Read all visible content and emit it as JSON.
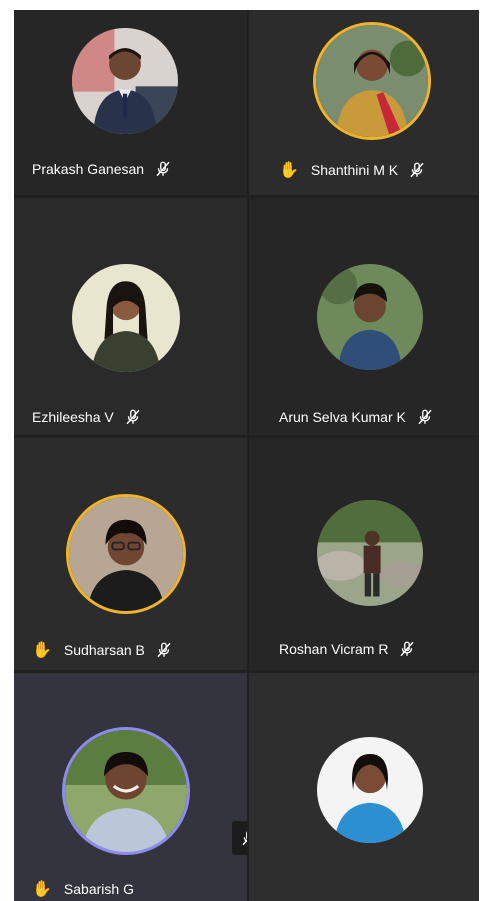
{
  "participants": [
    {
      "name": "Prakash Ganesan",
      "hand_raised": false,
      "muted": true
    },
    {
      "name": "Shanthini M K",
      "hand_raised": true,
      "muted": true
    },
    {
      "name": "Ezhileesha V",
      "hand_raised": false,
      "muted": true
    },
    {
      "name": "Arun Selva Kumar K",
      "hand_raised": false,
      "muted": true
    },
    {
      "name": "Sudharsan B",
      "hand_raised": true,
      "muted": true
    },
    {
      "name": "Roshan Vicram R",
      "hand_raised": false,
      "muted": true
    },
    {
      "name": "Sabarish G",
      "hand_raised": true,
      "muted": true,
      "speaking": true
    },
    {
      "name": "",
      "hand_raised": false,
      "muted": true
    }
  ],
  "icons": {
    "mic_off": "mic-off-icon",
    "hand": "raised-hand-icon"
  },
  "colors": {
    "tile_dark": "#252525",
    "tile_mid": "#2e2e2e",
    "tile_active": "#33333f",
    "hand_ring": "#f0b429",
    "speaking_ring": "#8b8cf0"
  }
}
